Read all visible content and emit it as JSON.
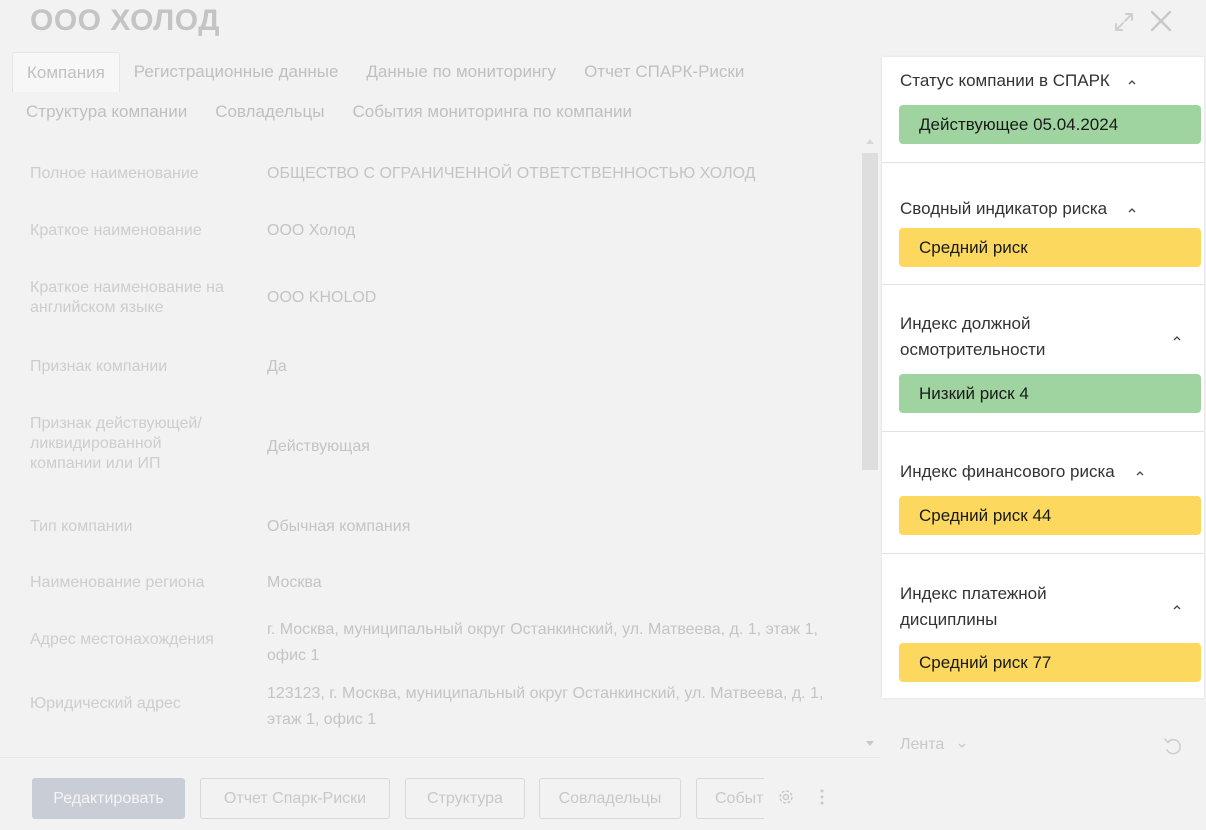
{
  "window": {
    "title": "ООО ХОЛОД"
  },
  "icons": {
    "expand": "expand-icon",
    "close": "close-icon",
    "gear": "gear-icon",
    "more": "more-icon",
    "undo": "undo-icon",
    "chevron": "chevron-icon"
  },
  "tabs": [
    {
      "label": "Компания",
      "active": true
    },
    {
      "label": "Регистрационные данные"
    },
    {
      "label": "Данные по мониторингу"
    },
    {
      "label": "Отчет СПАРК-Риски"
    },
    {
      "label": "Структура компании"
    },
    {
      "label": "Совладельцы"
    },
    {
      "label": "События мониторинга по компании"
    }
  ],
  "fields": [
    {
      "label": "Полное наименование",
      "value": "ОБЩЕСТВО С ОГРАНИЧЕННОЙ ОТВЕТСТВЕННОСТЬЮ ХОЛОД"
    },
    {
      "label": "Краткое наименование",
      "value": "ООО Холод"
    },
    {
      "label": "Краткое наименование на английском языке",
      "value": "ООО KHOLOD"
    },
    {
      "label": "Признак компании",
      "value": "Да"
    },
    {
      "label": "Признак действующей/ ликвидированной компании или ИП",
      "value": "Действующая"
    },
    {
      "label": "Тип компании",
      "value": "Обычная компания"
    },
    {
      "label": "Наименование региона",
      "value": "Москва"
    },
    {
      "label": "Адрес местонахождения",
      "value": "г. Москва, муниципальный округ Останкинский, ул. Матвеева, д. 1, этаж 1, офис 1"
    },
    {
      "label": "Юридический адрес",
      "value": "123123, г. Москва, муниципальный округ Останкинский, ул. Матвеева, д. 1, этаж 1, офис 1"
    }
  ],
  "footer": {
    "edit": "Редактировать",
    "spark_report": "Отчет Спарк-Риски",
    "structure": "Структура",
    "owners": "Совладельцы",
    "events": "События"
  },
  "panel": {
    "sections": [
      {
        "title": "Статус компании в СПАРК",
        "badge": "Действующее 05.04.2024",
        "badge_color": "#9fd4a0"
      },
      {
        "title": "Сводный индикатор риска",
        "badge": "Средний риск",
        "badge_color": "#fcd85e"
      },
      {
        "title": "Индекс должной осмотрительности",
        "badge": "Низкий риск 4",
        "badge_color": "#9fd4a0"
      },
      {
        "title": "Индекс финансового риска",
        "badge": "Средний риск 44",
        "badge_color": "#fcd85e"
      },
      {
        "title": "Индекс платежной дисциплины",
        "badge": "Средний риск 77",
        "badge_color": "#fcd85e"
      }
    ]
  },
  "feed": {
    "label": "Лента"
  }
}
